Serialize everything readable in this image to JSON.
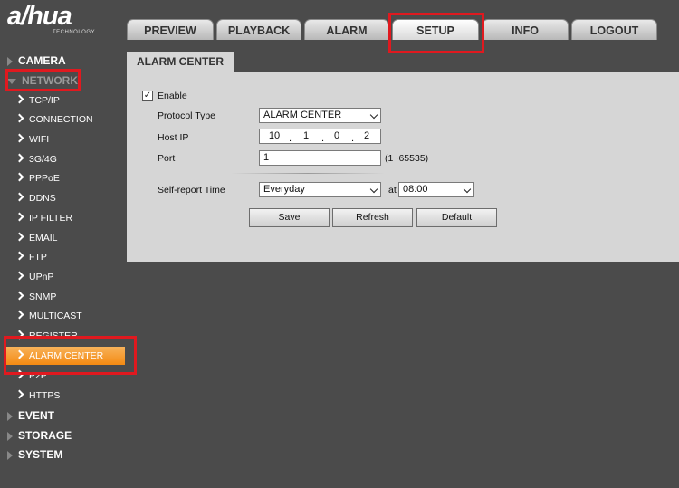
{
  "logo": {
    "word": "a/hua",
    "tagline": "TECHNOLOGY"
  },
  "tabs": [
    {
      "label": "PREVIEW"
    },
    {
      "label": "PLAYBACK"
    },
    {
      "label": "ALARM"
    },
    {
      "label": "SETUP",
      "active": true
    },
    {
      "label": "INFO"
    },
    {
      "label": "LOGOUT"
    }
  ],
  "sidebar": {
    "sections": [
      {
        "label": "CAMERA",
        "expanded": false
      },
      {
        "label": "NETWORK",
        "expanded": true
      },
      {
        "label": "EVENT",
        "expanded": false
      },
      {
        "label": "STORAGE",
        "expanded": false
      },
      {
        "label": "SYSTEM",
        "expanded": false
      }
    ],
    "network_items": [
      {
        "label": "TCP/IP"
      },
      {
        "label": "CONNECTION"
      },
      {
        "label": "WIFI"
      },
      {
        "label": "3G/4G"
      },
      {
        "label": "PPPoE"
      },
      {
        "label": "DDNS"
      },
      {
        "label": "IP FILTER"
      },
      {
        "label": "EMAIL"
      },
      {
        "label": "FTP"
      },
      {
        "label": "UPnP"
      },
      {
        "label": "SNMP"
      },
      {
        "label": "MULTICAST"
      },
      {
        "label": "REGISTER"
      },
      {
        "label": "ALARM CENTER",
        "active": true
      },
      {
        "label": "P2P"
      },
      {
        "label": "HTTPS"
      }
    ]
  },
  "panel": {
    "title": "ALARM CENTER",
    "enable_label": "Enable",
    "enable_checked": "✓",
    "protocol_label": "Protocol Type",
    "protocol_value": "ALARM CENTER",
    "host_label": "Host IP",
    "host_ip": [
      "10",
      "1",
      "0",
      "2"
    ],
    "ip_dot": ".",
    "port_label": "Port",
    "port_value": "1",
    "port_range": "(1~65535)",
    "report_label": "Self-report Time",
    "report_value": "Everyday",
    "at_label": "at",
    "time_value": "08:00",
    "buttons": {
      "save": "Save",
      "refresh": "Refresh",
      "default": "Default"
    }
  },
  "colors": {
    "accent": "#f48a12",
    "highlight": "#e0191f",
    "background": "#4b4b4b",
    "panel": "#d6d6d6"
  }
}
